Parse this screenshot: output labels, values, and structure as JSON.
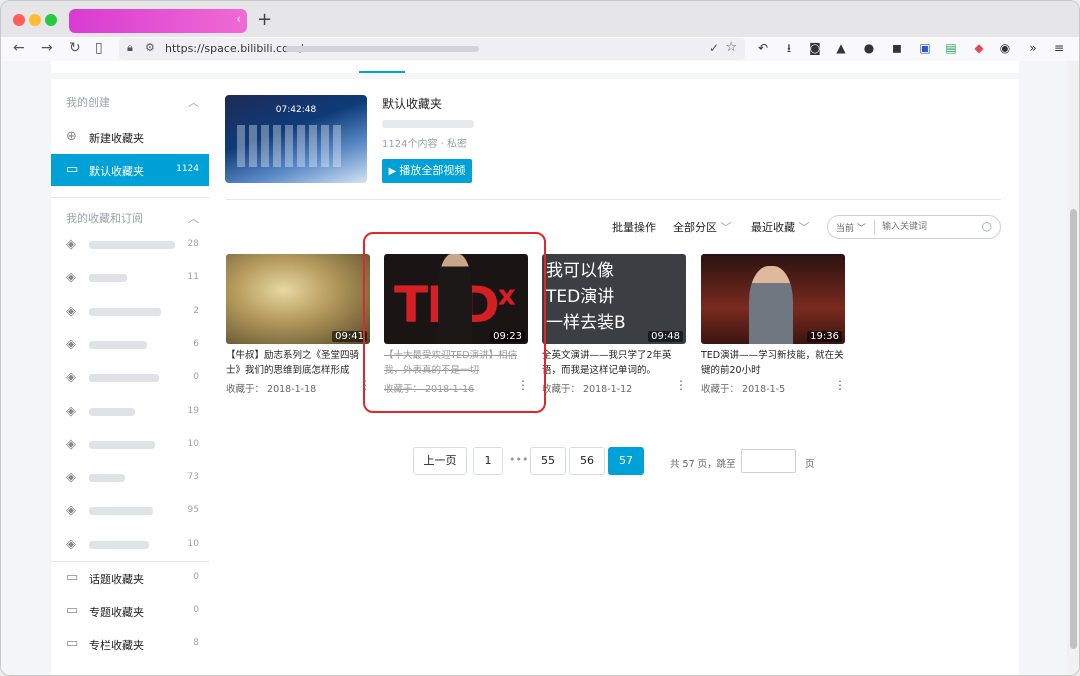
{
  "browser": {
    "url_host": "https://space.bilibili.com/",
    "tab_close": "‹",
    "new_tab": "+"
  },
  "sidebar": {
    "my_created": "我的创建",
    "new_folder": "新建收藏夹",
    "default_folder": {
      "label": "默认收藏夹",
      "count": "1124"
    },
    "my_collections": "我的收藏和订阅",
    "subscriptions": [
      {
        "count": "28",
        "blur_width": 86
      },
      {
        "count": "11",
        "blur_width": 38
      },
      {
        "count": "2",
        "blur_width": 72
      },
      {
        "count": "6",
        "blur_width": 58
      },
      {
        "count": "0",
        "blur_width": 70
      },
      {
        "count": "19",
        "blur_width": 46
      },
      {
        "count": "10",
        "blur_width": 66
      },
      {
        "count": "73",
        "blur_width": 36
      },
      {
        "count": "95",
        "blur_width": 64
      },
      {
        "count": "10",
        "blur_width": 60
      }
    ],
    "topic_folder": {
      "label": "话题收藏夹",
      "count": "0"
    },
    "special_folder": {
      "label": "专题收藏夹",
      "count": "0"
    },
    "column_folder": {
      "label": "专栏收藏夹",
      "count": "8"
    }
  },
  "folder": {
    "cover_time": "07:42:48",
    "title": "默认收藏夹",
    "meta": "1124个内容 · 私密",
    "play_all": "播放全部视频"
  },
  "toolbar": {
    "batch": "批量操作",
    "all_zones": "全部分区",
    "recent": "最近收藏",
    "scope": "当前",
    "search_placeholder": "输入关键词"
  },
  "videos": [
    {
      "title": "【牛叔】励志系列之《圣堂四骑士》我们的思维到底怎样形成",
      "duration": "09:41",
      "date": "收藏于： 2018-1-18"
    },
    {
      "title": "【十大最受欢迎TED演讲】相信我，外表真的不是一切",
      "duration": "09:23",
      "date": "收藏于： 2018-1-16",
      "thumb_text": "TED",
      "thumb_sup": "x"
    },
    {
      "title": "全英文演讲——我只学了2年英语，而我是这样记单词的。",
      "duration": "09:48",
      "date": "收藏于： 2018-1-12",
      "thumb_lines": [
        "我可以像",
        "TED演讲",
        "一样去装B"
      ]
    },
    {
      "title": "TED演讲——学习新技能，就在关键的前20小时",
      "duration": "19:36",
      "date": "收藏于： 2018-1-5"
    }
  ],
  "pagination": {
    "prev": "上一页",
    "pages": [
      "1",
      "55",
      "56",
      "57"
    ],
    "ellipsis": "•••",
    "total": "共 57 页，跳至",
    "unit": "页"
  },
  "colors": {
    "accent": "#00a1d6",
    "highlight": "#e0282b"
  }
}
